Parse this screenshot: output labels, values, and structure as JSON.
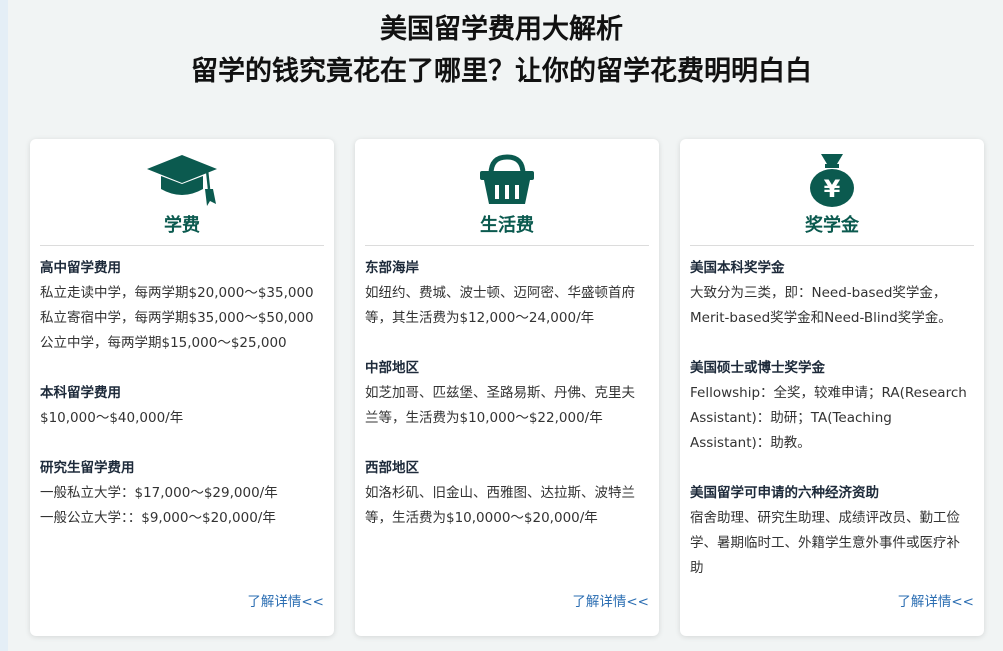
{
  "header": {
    "title": "美国留学费用大解析",
    "subtitle": "留学的钱究竟花在了哪里？让你的留学花费明明白白"
  },
  "colors": {
    "accent": "#0b5a4f",
    "link": "#2a6db2"
  },
  "cards": [
    {
      "icon": "graduation-cap-icon",
      "title": "学费",
      "more": "了解详情<<",
      "sections": [
        {
          "title": "高中留学费用",
          "lines": [
            "私立走读中学，每两学期$20,000～$35,000",
            "私立寄宿中学，每两学期$35,000～$50,000",
            "公立中学，每两学期$15,000～$25,000"
          ]
        },
        {
          "title": "本科留学费用",
          "lines": [
            "$10,000～$40,000/年"
          ]
        },
        {
          "title": "研究生留学费用",
          "lines": [
            "一般私立大学：$17,000～$29,000/年",
            "一般公立大学：：$9,000～$20,000/年"
          ]
        }
      ]
    },
    {
      "icon": "basket-icon",
      "title": "生活费",
      "more": "了解详情<<",
      "sections": [
        {
          "title": "东部海岸",
          "lines": [
            "如纽约、费城、波士顿、迈阿密、华盛顿首府",
            "等，其生活费为$12,000～24,000/年"
          ]
        },
        {
          "title": "中部地区",
          "lines": [
            "如芝加哥、匹兹堡、圣路易斯、丹佛、克里夫",
            "兰等，生活费为$10,000～$22,000/年"
          ]
        },
        {
          "title": "西部地区",
          "lines": [
            "如洛杉矶、旧金山、西雅图、达拉斯、波特兰",
            "等，生活费为$10,0000～$20,000/年"
          ]
        }
      ]
    },
    {
      "icon": "money-bag-yen-icon",
      "title": "奖学金",
      "more": "了解详情<<",
      "sections": [
        {
          "title": "美国本科奖学金",
          "lines": [
            "大致分为三类，即：Need-based奖学金，",
            "Merit-based奖学金和Need-Blind奖学金。"
          ]
        },
        {
          "title": "美国硕士或博士奖学金",
          "lines": [
            "Fellowship：全奖，较难申请；RA(Research",
            "Assistant)：助研；TA(Teaching",
            "Assistant)：助教。"
          ]
        },
        {
          "title": "美国留学可申请的六种经济资助",
          "lines": [
            "宿舍助理、研究生助理、成绩评改员、勤工俭",
            "学、暑期临时工、外籍学生意外事件或医疗补",
            "助"
          ]
        }
      ]
    }
  ]
}
